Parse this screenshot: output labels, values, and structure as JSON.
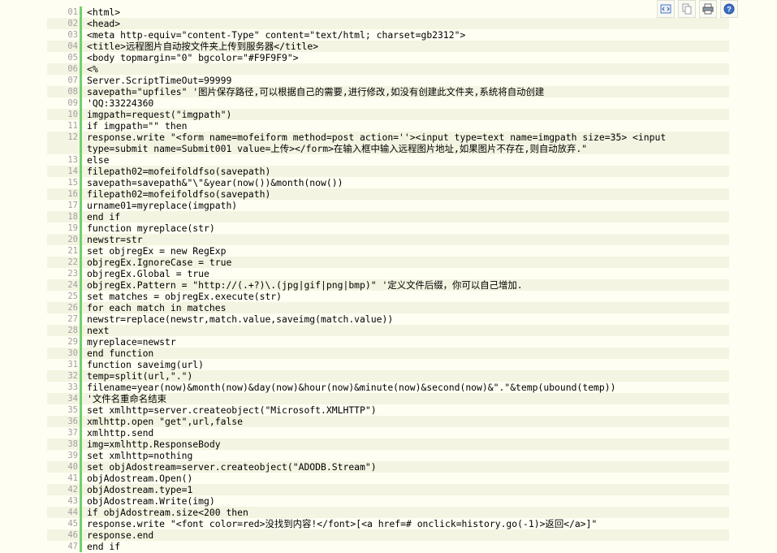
{
  "toolbar": {
    "icons": [
      "view-source-icon",
      "copy-icon",
      "print-icon",
      "help-icon"
    ]
  },
  "lines": [
    {
      "n": "01",
      "t": "<html>"
    },
    {
      "n": "02",
      "t": "<head>"
    },
    {
      "n": "03",
      "t": "<meta http-equiv=\"content-Type\" content=\"text/html; charset=gb2312\">"
    },
    {
      "n": "04",
      "t": "<title>远程图片自动按文件夹上传到服务器</title>"
    },
    {
      "n": "05",
      "t": "<body topmargin=\"0\" bgcolor=\"#F9F9F9\">"
    },
    {
      "n": "06",
      "t": "<%"
    },
    {
      "n": "07",
      "t": "Server.ScriptTimeOut=99999"
    },
    {
      "n": "08",
      "t": "savepath=\"upfiles\" '图片保存路径,可以根据自己的需要,进行修改,如没有创建此文件夹,系统将自动创建"
    },
    {
      "n": "09",
      "t": "'QQ:33224360"
    },
    {
      "n": "10",
      "t": "imgpath=request(\"imgpath\")"
    },
    {
      "n": "11",
      "t": "if imgpath=\"\" then"
    },
    {
      "n": "12",
      "t": "response.write \"<form name=mofeiform method=post action=''><input type=text name=imgpath size=35> <input type=submit name=Submit001 value=上传></form>在输入框中输入远程图片地址,如果图片不存在,则自动放弃.\""
    },
    {
      "n": "13",
      "t": "else"
    },
    {
      "n": "14",
      "t": "filepath02=mofeifoldfso(savepath)"
    },
    {
      "n": "15",
      "t": "savepath=savepath&\"\\\"&year(now())&month(now())"
    },
    {
      "n": "16",
      "t": "filepath02=mofeifoldfso(savepath)"
    },
    {
      "n": "17",
      "t": "urname01=myreplace(imgpath)"
    },
    {
      "n": "18",
      "t": "end if"
    },
    {
      "n": "19",
      "t": "function myreplace(str)"
    },
    {
      "n": "20",
      "t": "newstr=str"
    },
    {
      "n": "21",
      "t": "set objregEx = new RegExp"
    },
    {
      "n": "22",
      "t": "objregEx.IgnoreCase = true"
    },
    {
      "n": "23",
      "t": "objregEx.Global = true"
    },
    {
      "n": "24",
      "t": "objregEx.Pattern = \"http://(.+?)\\.(jpg|gif|png|bmp)\" '定义文件后缀，你可以自己增加."
    },
    {
      "n": "25",
      "t": "set matches = objregEx.execute(str)"
    },
    {
      "n": "26",
      "t": "for each match in matches"
    },
    {
      "n": "27",
      "t": "newstr=replace(newstr,match.value,saveimg(match.value))"
    },
    {
      "n": "28",
      "t": "next"
    },
    {
      "n": "29",
      "t": "myreplace=newstr"
    },
    {
      "n": "30",
      "t": "end function"
    },
    {
      "n": "31",
      "t": "function saveimg(url)"
    },
    {
      "n": "32",
      "t": "temp=split(url,\".\")"
    },
    {
      "n": "33",
      "t": "filename=year(now)&month(now)&day(now)&hour(now)&minute(now)&second(now)&\".\"&temp(ubound(temp))"
    },
    {
      "n": "34",
      "t": "'文件名重命名结束"
    },
    {
      "n": "35",
      "t": "set xmlhttp=server.createobject(\"Microsoft.XMLHTTP\")"
    },
    {
      "n": "36",
      "t": "xmlhttp.open \"get\",url,false"
    },
    {
      "n": "37",
      "t": "xmlhttp.send"
    },
    {
      "n": "38",
      "t": "img=xmlhttp.ResponseBody"
    },
    {
      "n": "39",
      "t": "set xmlhttp=nothing"
    },
    {
      "n": "40",
      "t": "set objAdostream=server.createobject(\"ADODB.Stream\")"
    },
    {
      "n": "41",
      "t": "objAdostream.Open()"
    },
    {
      "n": "42",
      "t": "objAdostream.type=1"
    },
    {
      "n": "43",
      "t": "objAdostream.Write(img)"
    },
    {
      "n": "44",
      "t": "if objAdostream.size<200 then"
    },
    {
      "n": "45",
      "t": "response.write \"<font color=red>没找到内容!</font>[<a href=# onclick=history.go(-1)>返回</a>]\""
    },
    {
      "n": "46",
      "t": "response.end"
    },
    {
      "n": "47",
      "t": "end if"
    }
  ]
}
